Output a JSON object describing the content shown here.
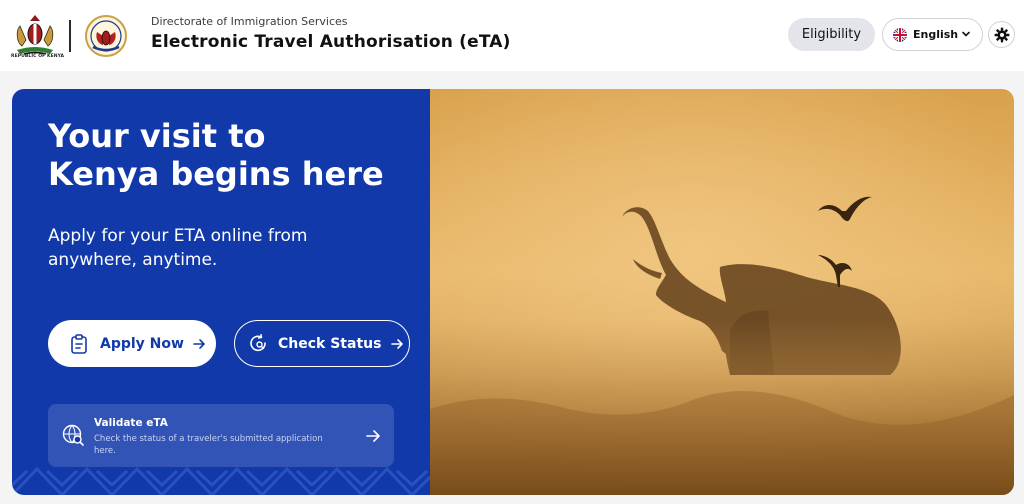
{
  "header": {
    "coat_of_arms_caption": "REPUBLIC OF KENYA",
    "directorate": "Directorate of Immigration Services",
    "title": "Electronic Travel Authorisation (eTA)",
    "eligibility_label": "Eligibility",
    "language": {
      "selected": "English",
      "flag_icon": "uk-flag-icon"
    },
    "settings_icon": "gear-icon"
  },
  "hero": {
    "title_lines": [
      "Your visit to",
      "Kenya begins here"
    ],
    "subtitle_lines": [
      "Apply for your ETA online from",
      "anywhere, anytime."
    ],
    "apply_label": "Apply Now",
    "check_status_label": "Check Status",
    "validate": {
      "title": "Validate eTA",
      "description_lines": [
        "Check the status of a traveler's submitted application",
        "here."
      ]
    },
    "image_subject": "elephant-silhouette-sunrise"
  },
  "colors": {
    "brand_blue": "#1139aa",
    "header_bg": "#ffffff",
    "page_bg": "#f4f4f5",
    "eligibility_bg": "#e4e5ea",
    "photo_gold": "#d9a14c"
  }
}
